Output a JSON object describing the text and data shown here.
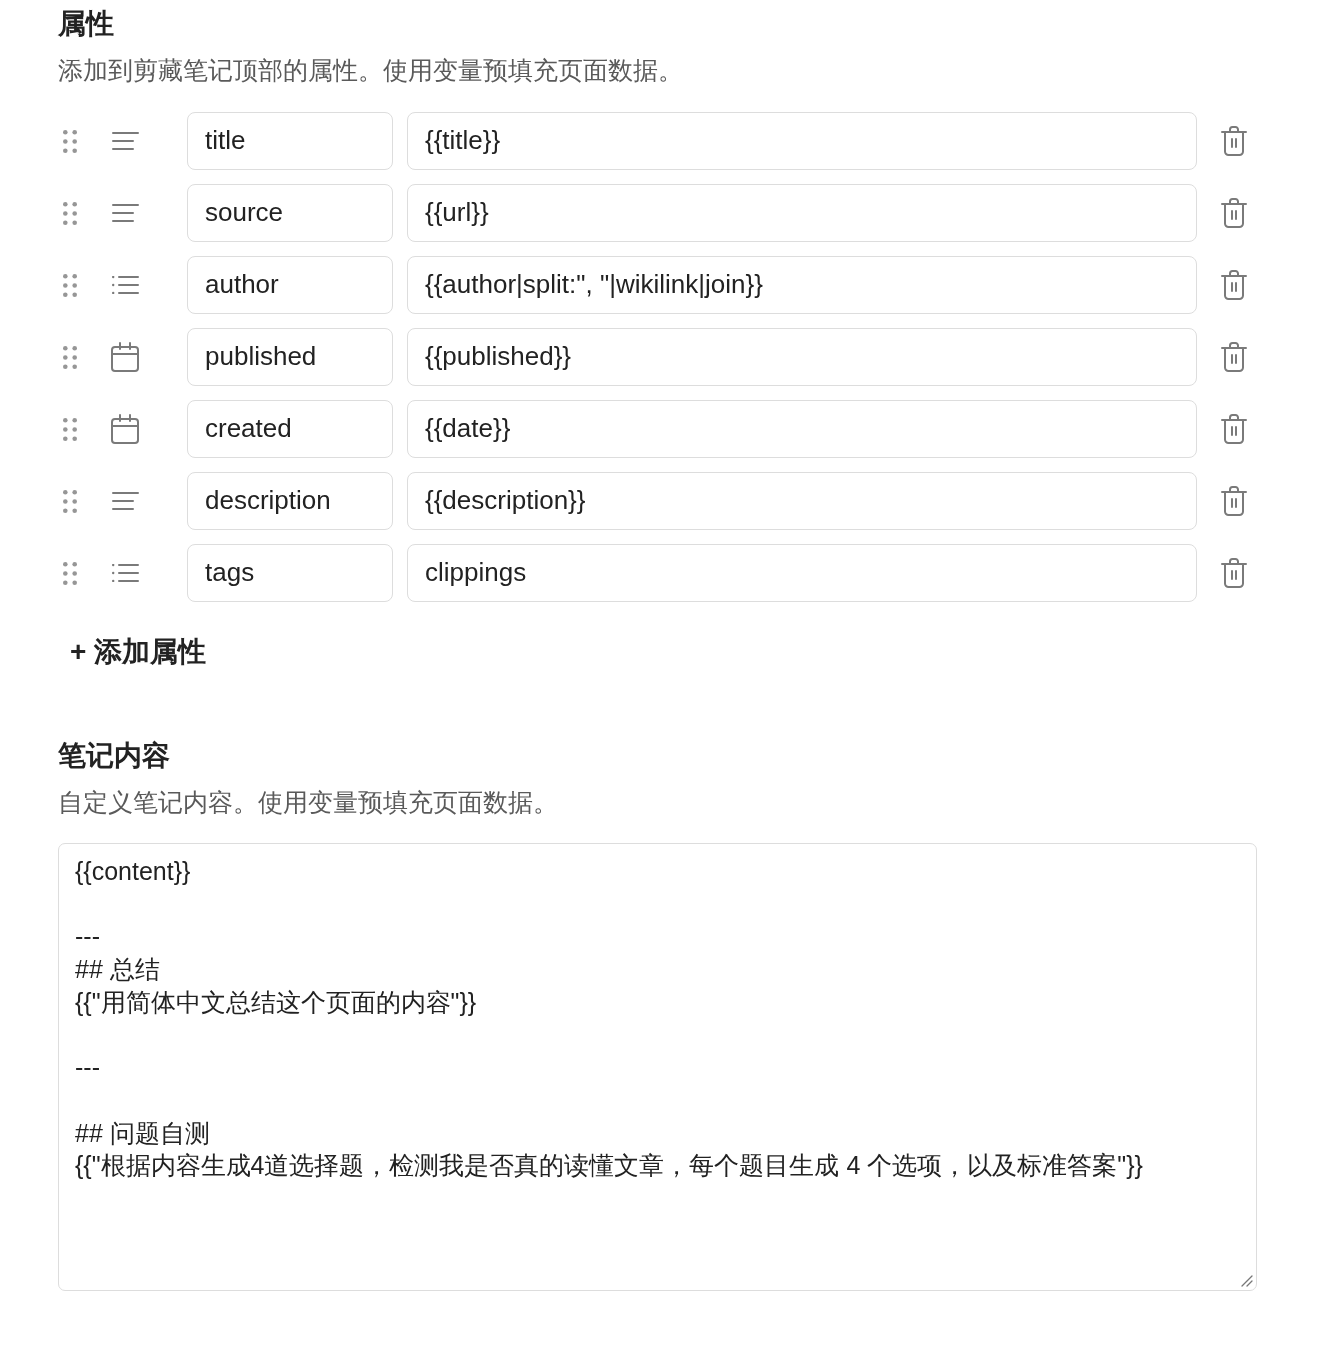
{
  "properties_section": {
    "title": "属性",
    "description": "添加到剪藏笔记顶部的属性。使用变量预填充页面数据。",
    "properties": [
      {
        "kind": "text",
        "name": "title",
        "value": "{{title}}"
      },
      {
        "kind": "text",
        "name": "source",
        "value": "{{url}}"
      },
      {
        "kind": "list",
        "name": "author",
        "value": "{{author|split:\", \"|wikilink|join}}"
      },
      {
        "kind": "date",
        "name": "published",
        "value": "{{published}}"
      },
      {
        "kind": "date",
        "name": "created",
        "value": "{{date}}"
      },
      {
        "kind": "text",
        "name": "description",
        "value": "{{description}}"
      },
      {
        "kind": "list",
        "name": "tags",
        "value": "clippings"
      }
    ],
    "add_button": {
      "label": "+ 添加属性"
    }
  },
  "note_content_section": {
    "title": "笔记内容",
    "description": "自定义笔记内容。使用变量预填充页面数据。",
    "value": "{{content}}\n\n---\n## 总结\n{{\"用简体中文总结这个页面的内容\"}}\n\n---\n\n## 问题自测\n{{\"根据内容生成4道选择题，检测我是否真的读懂文章，每个题目生成 4 个选项，以及标准答案\"}}"
  }
}
